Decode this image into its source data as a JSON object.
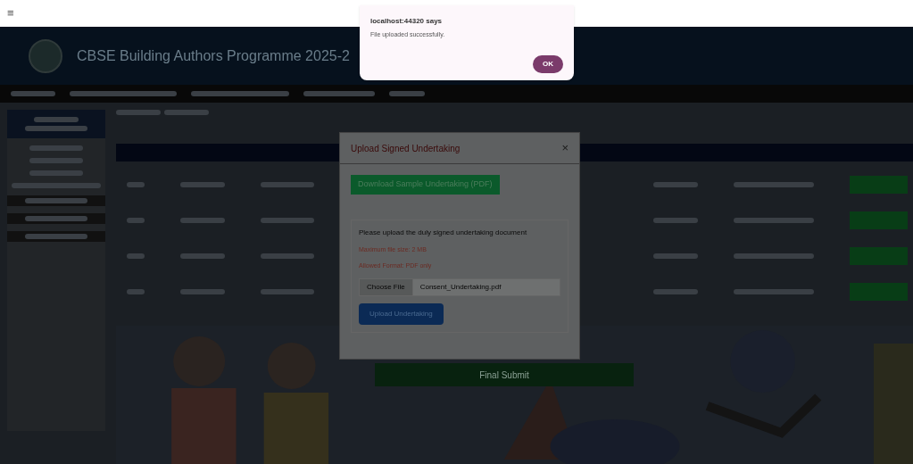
{
  "browser": {
    "menu_icon": "≡"
  },
  "alert": {
    "title": "localhost:44320 says",
    "message": "File uploaded successfully.",
    "button": "OK"
  },
  "header": {
    "title": "CBSE Building Authors Programme 2025-2"
  },
  "modal": {
    "title": "Upload Signed Undertaking",
    "close": "×",
    "download_button": "Download Sample Undertaking (PDF)",
    "instruction": "Please upload the duly signed undertaking document",
    "max_size": "Maximum file size: 2 MB",
    "format": "Allowed Format: PDF only",
    "file_button": "Choose File",
    "file_name": "Consent_Undertaking.pdf",
    "upload_button": "Upload Undertaking"
  },
  "banner": {
    "button": "Final Submit"
  }
}
